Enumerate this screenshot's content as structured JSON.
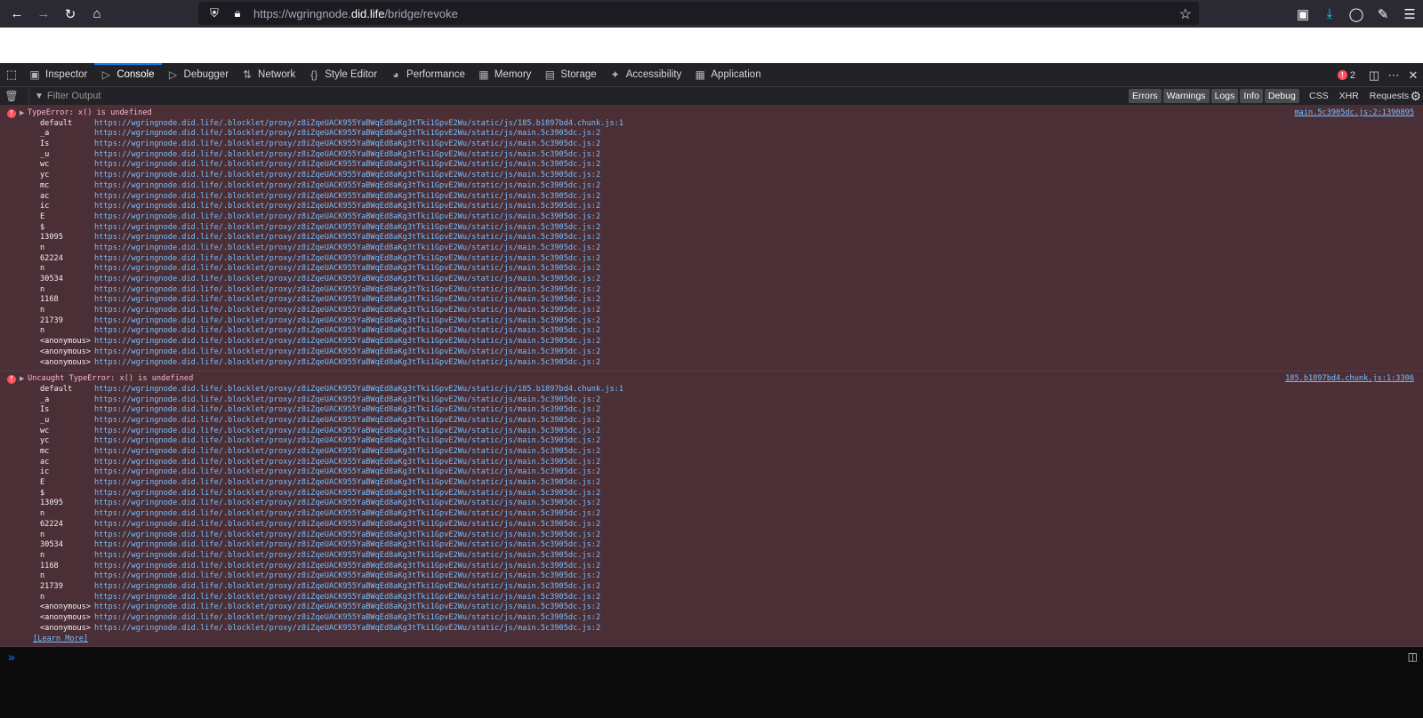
{
  "browser": {
    "url_prefix": "https://wgringnode.",
    "url_host": "did.life",
    "url_path": "/bridge/revoke"
  },
  "devtools": {
    "tabs": [
      {
        "label": "Inspector",
        "icon": "inspector-icon"
      },
      {
        "label": "Console",
        "icon": "console-icon"
      },
      {
        "label": "Debugger",
        "icon": "debugger-icon"
      },
      {
        "label": "Network",
        "icon": "network-icon"
      },
      {
        "label": "Style Editor",
        "icon": "style-editor-icon"
      },
      {
        "label": "Performance",
        "icon": "performance-icon"
      },
      {
        "label": "Memory",
        "icon": "memory-icon"
      },
      {
        "label": "Storage",
        "icon": "storage-icon"
      },
      {
        "label": "Accessibility",
        "icon": "accessibility-icon"
      },
      {
        "label": "Application",
        "icon": "application-icon"
      }
    ],
    "active_tab": "Console",
    "error_count": "2"
  },
  "console_toolbar": {
    "filter_placeholder": "Filter Output",
    "levels": [
      "Errors",
      "Warnings",
      "Logs",
      "Info",
      "Debug"
    ],
    "types": [
      "CSS",
      "XHR",
      "Requests"
    ]
  },
  "messages": [
    {
      "text": "TypeError: x() is undefined",
      "location": "main.5c3905dc.js:2:1390895",
      "frames": [
        {
          "fn": "default",
          "loc": "https://wgringnode.did.life/.blocklet/proxy/z8iZqeUACK955YaBWqEd8aKg3tTki1GpvE2Wu/static/js/185.b1897bd4.chunk.js:1"
        },
        {
          "fn": "_a",
          "loc": "https://wgringnode.did.life/.blocklet/proxy/z8iZqeUACK955YaBWqEd8aKg3tTki1GpvE2Wu/static/js/main.5c3905dc.js:2"
        },
        {
          "fn": "Is",
          "loc": "https://wgringnode.did.life/.blocklet/proxy/z8iZqeUACK955YaBWqEd8aKg3tTki1GpvE2Wu/static/js/main.5c3905dc.js:2"
        },
        {
          "fn": "_u",
          "loc": "https://wgringnode.did.life/.blocklet/proxy/z8iZqeUACK955YaBWqEd8aKg3tTki1GpvE2Wu/static/js/main.5c3905dc.js:2"
        },
        {
          "fn": "wc",
          "loc": "https://wgringnode.did.life/.blocklet/proxy/z8iZqeUACK955YaBWqEd8aKg3tTki1GpvE2Wu/static/js/main.5c3905dc.js:2"
        },
        {
          "fn": "yc",
          "loc": "https://wgringnode.did.life/.blocklet/proxy/z8iZqeUACK955YaBWqEd8aKg3tTki1GpvE2Wu/static/js/main.5c3905dc.js:2"
        },
        {
          "fn": "mc",
          "loc": "https://wgringnode.did.life/.blocklet/proxy/z8iZqeUACK955YaBWqEd8aKg3tTki1GpvE2Wu/static/js/main.5c3905dc.js:2"
        },
        {
          "fn": "ac",
          "loc": "https://wgringnode.did.life/.blocklet/proxy/z8iZqeUACK955YaBWqEd8aKg3tTki1GpvE2Wu/static/js/main.5c3905dc.js:2"
        },
        {
          "fn": "ic",
          "loc": "https://wgringnode.did.life/.blocklet/proxy/z8iZqeUACK955YaBWqEd8aKg3tTki1GpvE2Wu/static/js/main.5c3905dc.js:2"
        },
        {
          "fn": "E",
          "loc": "https://wgringnode.did.life/.blocklet/proxy/z8iZqeUACK955YaBWqEd8aKg3tTki1GpvE2Wu/static/js/main.5c3905dc.js:2"
        },
        {
          "fn": "$",
          "loc": "https://wgringnode.did.life/.blocklet/proxy/z8iZqeUACK955YaBWqEd8aKg3tTki1GpvE2Wu/static/js/main.5c3905dc.js:2"
        },
        {
          "fn": "13095",
          "loc": "https://wgringnode.did.life/.blocklet/proxy/z8iZqeUACK955YaBWqEd8aKg3tTki1GpvE2Wu/static/js/main.5c3905dc.js:2"
        },
        {
          "fn": "n",
          "loc": "https://wgringnode.did.life/.blocklet/proxy/z8iZqeUACK955YaBWqEd8aKg3tTki1GpvE2Wu/static/js/main.5c3905dc.js:2"
        },
        {
          "fn": "62224",
          "loc": "https://wgringnode.did.life/.blocklet/proxy/z8iZqeUACK955YaBWqEd8aKg3tTki1GpvE2Wu/static/js/main.5c3905dc.js:2"
        },
        {
          "fn": "n",
          "loc": "https://wgringnode.did.life/.blocklet/proxy/z8iZqeUACK955YaBWqEd8aKg3tTki1GpvE2Wu/static/js/main.5c3905dc.js:2"
        },
        {
          "fn": "30534",
          "loc": "https://wgringnode.did.life/.blocklet/proxy/z8iZqeUACK955YaBWqEd8aKg3tTki1GpvE2Wu/static/js/main.5c3905dc.js:2"
        },
        {
          "fn": "n",
          "loc": "https://wgringnode.did.life/.blocklet/proxy/z8iZqeUACK955YaBWqEd8aKg3tTki1GpvE2Wu/static/js/main.5c3905dc.js:2"
        },
        {
          "fn": "1168",
          "loc": "https://wgringnode.did.life/.blocklet/proxy/z8iZqeUACK955YaBWqEd8aKg3tTki1GpvE2Wu/static/js/main.5c3905dc.js:2"
        },
        {
          "fn": "n",
          "loc": "https://wgringnode.did.life/.blocklet/proxy/z8iZqeUACK955YaBWqEd8aKg3tTki1GpvE2Wu/static/js/main.5c3905dc.js:2"
        },
        {
          "fn": "21739",
          "loc": "https://wgringnode.did.life/.blocklet/proxy/z8iZqeUACK955YaBWqEd8aKg3tTki1GpvE2Wu/static/js/main.5c3905dc.js:2"
        },
        {
          "fn": "n",
          "loc": "https://wgringnode.did.life/.blocklet/proxy/z8iZqeUACK955YaBWqEd8aKg3tTki1GpvE2Wu/static/js/main.5c3905dc.js:2"
        },
        {
          "fn": "<anonymous>",
          "loc": "https://wgringnode.did.life/.blocklet/proxy/z8iZqeUACK955YaBWqEd8aKg3tTki1GpvE2Wu/static/js/main.5c3905dc.js:2"
        },
        {
          "fn": "<anonymous>",
          "loc": "https://wgringnode.did.life/.blocklet/proxy/z8iZqeUACK955YaBWqEd8aKg3tTki1GpvE2Wu/static/js/main.5c3905dc.js:2"
        },
        {
          "fn": "<anonymous>",
          "loc": "https://wgringnode.did.life/.blocklet/proxy/z8iZqeUACK955YaBWqEd8aKg3tTki1GpvE2Wu/static/js/main.5c3905dc.js:2"
        }
      ]
    },
    {
      "text": "Uncaught TypeError: x() is undefined",
      "location": "185.b1897bd4.chunk.js:1:3306",
      "learn_more": "[Learn More]",
      "frames": [
        {
          "fn": "default",
          "loc": "https://wgringnode.did.life/.blocklet/proxy/z8iZqeUACK955YaBWqEd8aKg3tTki1GpvE2Wu/static/js/185.b1897bd4.chunk.js:1"
        },
        {
          "fn": "_a",
          "loc": "https://wgringnode.did.life/.blocklet/proxy/z8iZqeUACK955YaBWqEd8aKg3tTki1GpvE2Wu/static/js/main.5c3905dc.js:2"
        },
        {
          "fn": "Is",
          "loc": "https://wgringnode.did.life/.blocklet/proxy/z8iZqeUACK955YaBWqEd8aKg3tTki1GpvE2Wu/static/js/main.5c3905dc.js:2"
        },
        {
          "fn": "_u",
          "loc": "https://wgringnode.did.life/.blocklet/proxy/z8iZqeUACK955YaBWqEd8aKg3tTki1GpvE2Wu/static/js/main.5c3905dc.js:2"
        },
        {
          "fn": "wc",
          "loc": "https://wgringnode.did.life/.blocklet/proxy/z8iZqeUACK955YaBWqEd8aKg3tTki1GpvE2Wu/static/js/main.5c3905dc.js:2"
        },
        {
          "fn": "yc",
          "loc": "https://wgringnode.did.life/.blocklet/proxy/z8iZqeUACK955YaBWqEd8aKg3tTki1GpvE2Wu/static/js/main.5c3905dc.js:2"
        },
        {
          "fn": "mc",
          "loc": "https://wgringnode.did.life/.blocklet/proxy/z8iZqeUACK955YaBWqEd8aKg3tTki1GpvE2Wu/static/js/main.5c3905dc.js:2"
        },
        {
          "fn": "ac",
          "loc": "https://wgringnode.did.life/.blocklet/proxy/z8iZqeUACK955YaBWqEd8aKg3tTki1GpvE2Wu/static/js/main.5c3905dc.js:2"
        },
        {
          "fn": "ic",
          "loc": "https://wgringnode.did.life/.blocklet/proxy/z8iZqeUACK955YaBWqEd8aKg3tTki1GpvE2Wu/static/js/main.5c3905dc.js:2"
        },
        {
          "fn": "E",
          "loc": "https://wgringnode.did.life/.blocklet/proxy/z8iZqeUACK955YaBWqEd8aKg3tTki1GpvE2Wu/static/js/main.5c3905dc.js:2"
        },
        {
          "fn": "$",
          "loc": "https://wgringnode.did.life/.blocklet/proxy/z8iZqeUACK955YaBWqEd8aKg3tTki1GpvE2Wu/static/js/main.5c3905dc.js:2"
        },
        {
          "fn": "13095",
          "loc": "https://wgringnode.did.life/.blocklet/proxy/z8iZqeUACK955YaBWqEd8aKg3tTki1GpvE2Wu/static/js/main.5c3905dc.js:2"
        },
        {
          "fn": "n",
          "loc": "https://wgringnode.did.life/.blocklet/proxy/z8iZqeUACK955YaBWqEd8aKg3tTki1GpvE2Wu/static/js/main.5c3905dc.js:2"
        },
        {
          "fn": "62224",
          "loc": "https://wgringnode.did.life/.blocklet/proxy/z8iZqeUACK955YaBWqEd8aKg3tTki1GpvE2Wu/static/js/main.5c3905dc.js:2"
        },
        {
          "fn": "n",
          "loc": "https://wgringnode.did.life/.blocklet/proxy/z8iZqeUACK955YaBWqEd8aKg3tTki1GpvE2Wu/static/js/main.5c3905dc.js:2"
        },
        {
          "fn": "30534",
          "loc": "https://wgringnode.did.life/.blocklet/proxy/z8iZqeUACK955YaBWqEd8aKg3tTki1GpvE2Wu/static/js/main.5c3905dc.js:2"
        },
        {
          "fn": "n",
          "loc": "https://wgringnode.did.life/.blocklet/proxy/z8iZqeUACK955YaBWqEd8aKg3tTki1GpvE2Wu/static/js/main.5c3905dc.js:2"
        },
        {
          "fn": "1168",
          "loc": "https://wgringnode.did.life/.blocklet/proxy/z8iZqeUACK955YaBWqEd8aKg3tTki1GpvE2Wu/static/js/main.5c3905dc.js:2"
        },
        {
          "fn": "n",
          "loc": "https://wgringnode.did.life/.blocklet/proxy/z8iZqeUACK955YaBWqEd8aKg3tTki1GpvE2Wu/static/js/main.5c3905dc.js:2"
        },
        {
          "fn": "21739",
          "loc": "https://wgringnode.did.life/.blocklet/proxy/z8iZqeUACK955YaBWqEd8aKg3tTki1GpvE2Wu/static/js/main.5c3905dc.js:2"
        },
        {
          "fn": "n",
          "loc": "https://wgringnode.did.life/.blocklet/proxy/z8iZqeUACK955YaBWqEd8aKg3tTki1GpvE2Wu/static/js/main.5c3905dc.js:2"
        },
        {
          "fn": "<anonymous>",
          "loc": "https://wgringnode.did.life/.blocklet/proxy/z8iZqeUACK955YaBWqEd8aKg3tTki1GpvE2Wu/static/js/main.5c3905dc.js:2"
        },
        {
          "fn": "<anonymous>",
          "loc": "https://wgringnode.did.life/.blocklet/proxy/z8iZqeUACK955YaBWqEd8aKg3tTki1GpvE2Wu/static/js/main.5c3905dc.js:2"
        },
        {
          "fn": "<anonymous>",
          "loc": "https://wgringnode.did.life/.blocklet/proxy/z8iZqeUACK955YaBWqEd8aKg3tTki1GpvE2Wu/static/js/main.5c3905dc.js:2"
        }
      ]
    }
  ],
  "colors": {
    "error_bg": "#4b2f36",
    "error_text": "#ffb3d2",
    "link": "#75bfff",
    "accent": "#0a84ff"
  }
}
